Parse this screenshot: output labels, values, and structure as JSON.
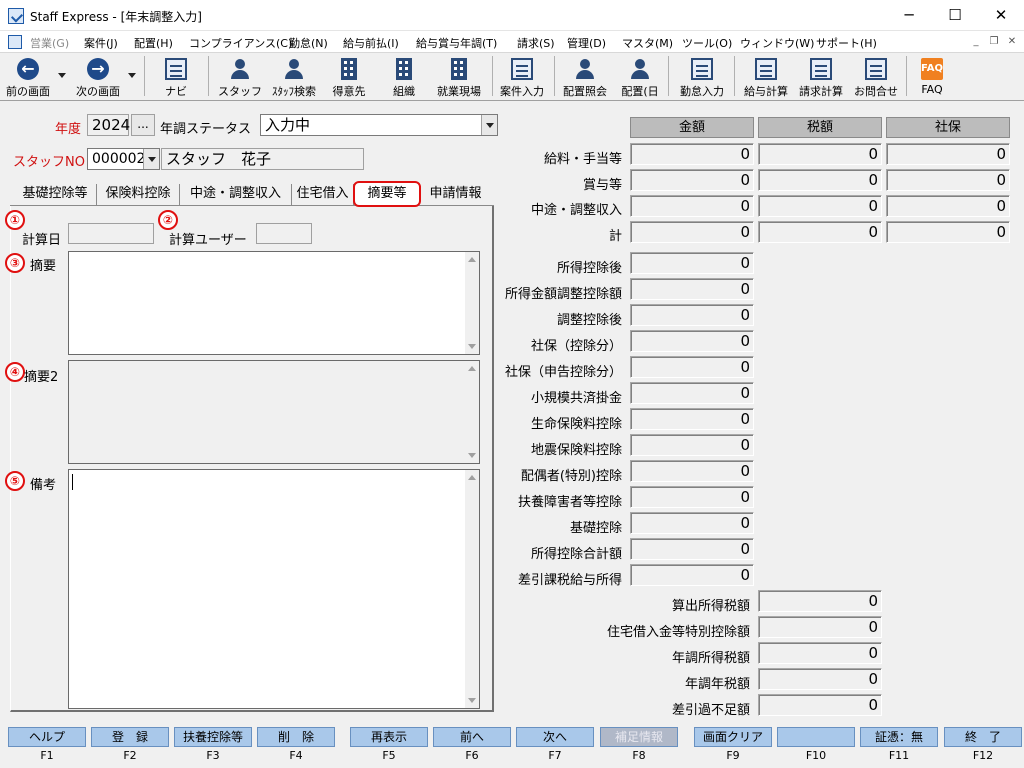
{
  "window": {
    "title": "Staff Express - [年末調整入力]",
    "minimize": "─",
    "maximize": "☐",
    "close": "✕"
  },
  "menu": [
    {
      "label": "営業(G)",
      "enabled": false
    },
    {
      "label": "案件(J)",
      "enabled": true
    },
    {
      "label": "配置(H)",
      "enabled": true
    },
    {
      "label": "コンプライアンス(C)",
      "enabled": true
    },
    {
      "label": "勤怠(N)",
      "enabled": true
    },
    {
      "label": "給与前払(I)",
      "enabled": true
    },
    {
      "label": "給与賞与年調(T)",
      "enabled": true
    },
    {
      "label": "請求(S)",
      "enabled": true
    },
    {
      "label": "管理(D)",
      "enabled": true
    },
    {
      "label": "マスタ(M)",
      "enabled": true
    },
    {
      "label": "ツール(O)",
      "enabled": true
    },
    {
      "label": "ウィンドウ(W)",
      "enabled": true
    },
    {
      "label": "サポート(H)",
      "enabled": true
    }
  ],
  "toolbar": {
    "prev": "前の画面",
    "next": "次の画面",
    "navi": "ナビ",
    "staff": "スタッフ",
    "staff_search": "ｽﾀｯﾌ検索",
    "client": "得意先",
    "org": "組織",
    "site": "就業現場",
    "case_input": "案件入力",
    "assign_inquiry": "配置照会",
    "assign_day": "配置(日",
    "attendance_input": "勤怠入力",
    "salary_calc": "給与計算",
    "billing_calc": "請求計算",
    "inquiry": "お問合せ",
    "faq": "FAQ"
  },
  "form": {
    "year_label": "年度",
    "year_value": "2024",
    "year_btn": "...",
    "status_label": "年調ステータス",
    "status_value": "入力中",
    "staff_no_label": "スタッフNO",
    "staff_no_value": "000002",
    "staff_name": "スタッフ　花子"
  },
  "tabs": [
    "基礎控除等",
    "保険料控除",
    "中途・調整収入",
    "住宅借入",
    "摘要等",
    "申請情報"
  ],
  "active_tab": "摘要等",
  "left": {
    "badges": [
      "①",
      "②",
      "③",
      "④",
      "⑤"
    ],
    "calc_date_label": "計算日",
    "calc_user_label": "計算ユーザー",
    "summary_label": "摘要",
    "summary2_label": "摘要2",
    "notes_label": "備考"
  },
  "grid": {
    "headers": [
      "金額",
      "税額",
      "社保"
    ],
    "rows": [
      {
        "label": "給料・手当等",
        "values": [
          "0",
          "0",
          "0"
        ]
      },
      {
        "label": "賞与等",
        "values": [
          "0",
          "0",
          "0"
        ]
      },
      {
        "label": "中途・調整収入",
        "values": [
          "0",
          "0",
          "0"
        ]
      },
      {
        "label": "計",
        "values": [
          "0",
          "0",
          "0"
        ]
      }
    ]
  },
  "deductions": [
    {
      "label": "所得控除後",
      "value": "0"
    },
    {
      "label": "所得金額調整控除額",
      "value": "0"
    },
    {
      "label": "調整控除後",
      "value": "0"
    },
    {
      "label": "社保（控除分）",
      "value": "0"
    },
    {
      "label": "社保（申告控除分）",
      "value": "0"
    },
    {
      "label": "小規模共済掛金",
      "value": "0"
    },
    {
      "label": "生命保険料控除",
      "value": "0"
    },
    {
      "label": "地震保険料控除",
      "value": "0"
    },
    {
      "label": "配偶者(特別)控除",
      "value": "0"
    },
    {
      "label": "扶養障害者等控除",
      "value": "0"
    },
    {
      "label": "基礎控除",
      "value": "0"
    },
    {
      "label": "所得控除合計額",
      "value": "0"
    },
    {
      "label": "差引課税給与所得",
      "value": "0"
    }
  ],
  "taxes": [
    {
      "label": "算出所得税額",
      "value": "0"
    },
    {
      "label": "住宅借入金等特別控除額",
      "value": "0"
    },
    {
      "label": "年調所得税額",
      "value": "0"
    },
    {
      "label": "年調年税額",
      "value": "0"
    },
    {
      "label": "差引過不足額",
      "value": "0"
    }
  ],
  "fkeys": [
    {
      "label": "ヘルプ",
      "key": "F1",
      "enabled": true
    },
    {
      "label": "登　録",
      "key": "F2",
      "enabled": true
    },
    {
      "label": "扶養控除等",
      "key": "F3",
      "enabled": true
    },
    {
      "label": "削　除",
      "key": "F4",
      "enabled": true
    },
    {
      "label": "再表示",
      "key": "F5",
      "enabled": true
    },
    {
      "label": "前へ",
      "key": "F6",
      "enabled": true
    },
    {
      "label": "次へ",
      "key": "F7",
      "enabled": true
    },
    {
      "label": "補足情報",
      "key": "F8",
      "enabled": false
    },
    {
      "label": "画面クリア",
      "key": "F9",
      "enabled": true
    },
    {
      "label": "",
      "key": "F10",
      "enabled": true
    },
    {
      "label": "証憑：無",
      "key": "F11",
      "enabled": true
    },
    {
      "label": "終　了",
      "key": "F12",
      "enabled": true
    }
  ],
  "colors": {
    "accent_red": "#e01010",
    "fkey_bg": "#a9c8ea",
    "header_gray": "#bcbcbc",
    "icon_blue": "#1f4a8a"
  }
}
